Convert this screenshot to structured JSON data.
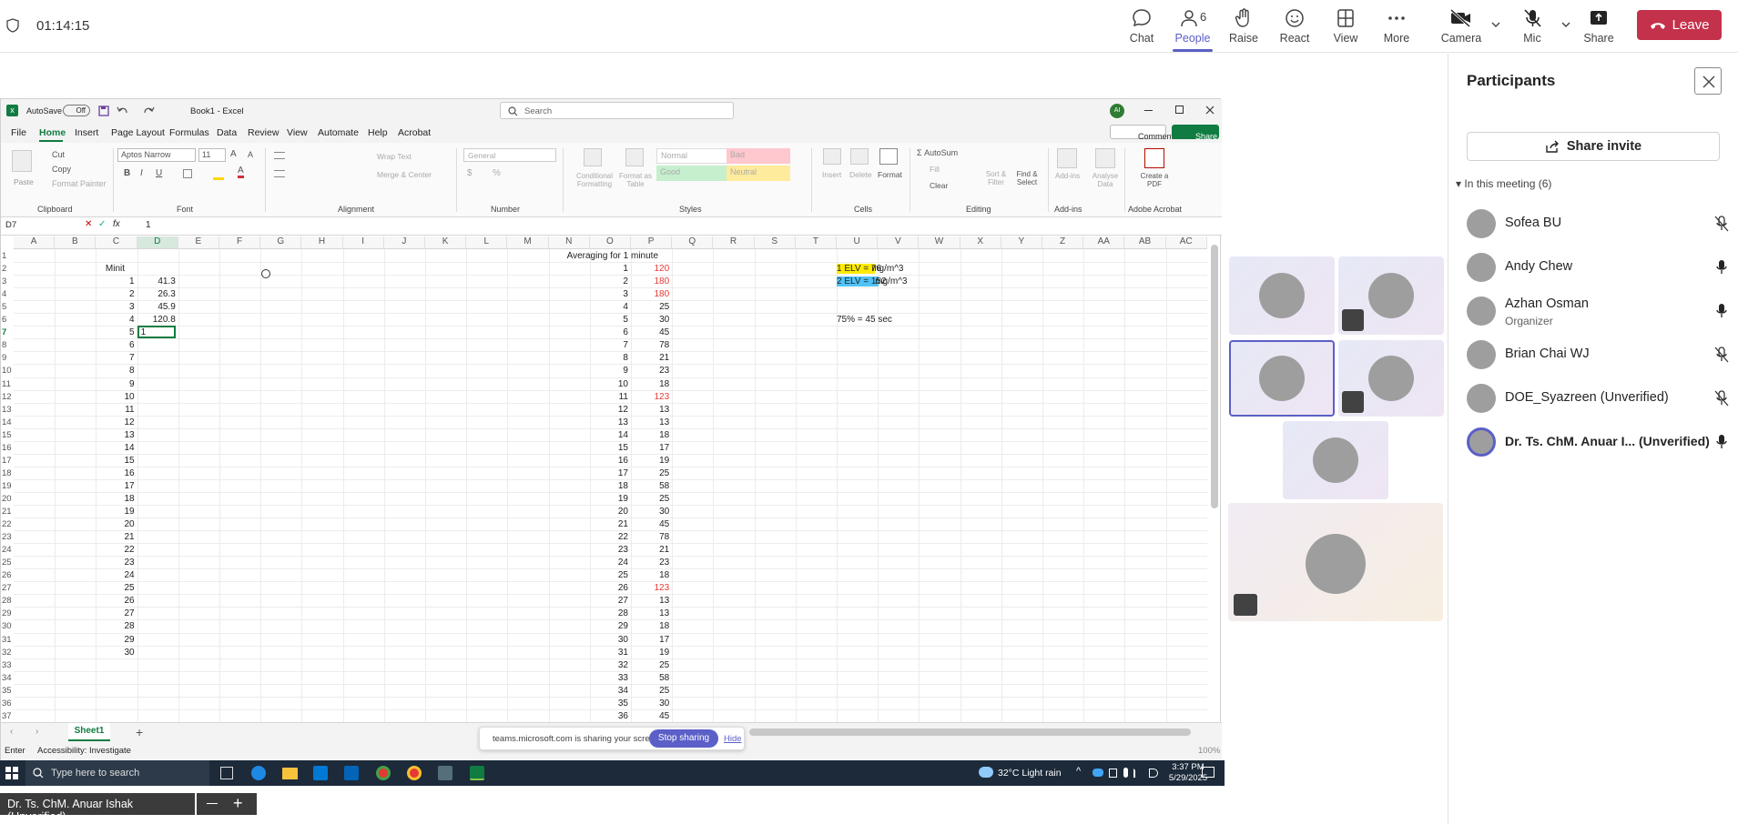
{
  "teams": {
    "timer": "01:14:15",
    "buttons": [
      {
        "label": "Chat",
        "icon": "chat-icon"
      },
      {
        "label": "People",
        "icon": "people-icon",
        "badge": "6"
      },
      {
        "label": "Raise",
        "icon": "raise-hand-icon"
      },
      {
        "label": "React",
        "icon": "react-icon"
      },
      {
        "label": "View",
        "icon": "view-icon"
      },
      {
        "label": "More",
        "icon": "more-icon"
      },
      {
        "label": "Camera",
        "icon": "camera-off-icon"
      },
      {
        "label": "Mic",
        "icon": "mic-off-icon"
      },
      {
        "label": "Share",
        "icon": "share-icon"
      }
    ],
    "leave_label": "Leave",
    "colors": {
      "accent": "#5b5fc7",
      "leave": "#c4314b"
    }
  },
  "excel": {
    "autosave_label": "AutoSave",
    "autosave_state": "Off",
    "title": "Book1 - Excel",
    "search_placeholder": "Search",
    "user_initial": "AI",
    "tabs": [
      "File",
      "Home",
      "Insert",
      "Page Layout",
      "Formulas",
      "Data",
      "Review",
      "View",
      "Automate",
      "Help",
      "Acrobat"
    ],
    "comments_label": "Comments",
    "share_label": "Share",
    "ribbon": {
      "paste": "Paste",
      "cut": "Cut",
      "copy": "Copy",
      "format_painter": "Format Painter",
      "clipboard": "Clipboard",
      "font_name": "Aptos Narrow",
      "font_size": "11",
      "font": "Font",
      "wrap_text": "Wrap Text",
      "merge_center": "Merge & Center",
      "alignment": "Alignment",
      "number_format": "General",
      "number": "Number",
      "conditional_formatting": "Conditional Formatting",
      "format_as_table": "Format as Table",
      "style_normal": "Normal",
      "style_bad": "Bad",
      "style_good": "Good",
      "style_neutral": "Neutral",
      "styles": "Styles",
      "insert": "Insert",
      "delete": "Delete",
      "format": "Format",
      "cells": "Cells",
      "autosum": "AutoSum",
      "fill": "Fill",
      "clear": "Clear",
      "sort_filter": "Sort & Filter",
      "find_select": "Find & Select",
      "editing": "Editing",
      "add_ins": "Add-ins",
      "analyse_data": "Analyse Data",
      "create_pdf": "Create a PDF",
      "adobe_acrobat": "Adobe Acrobat"
    },
    "name_box": "D7",
    "formula": "1",
    "columns": [
      "A",
      "B",
      "C",
      "D",
      "E",
      "F",
      "G",
      "H",
      "I",
      "J",
      "K",
      "L",
      "M",
      "N",
      "O",
      "P",
      "Q",
      "R",
      "S",
      "T",
      "U",
      "V",
      "W",
      "X",
      "Y",
      "Z",
      "AA",
      "AB",
      "AC"
    ],
    "rows": [
      "1",
      "2",
      "3",
      "4",
      "5",
      "6",
      "7",
      "8",
      "9",
      "10",
      "11",
      "12",
      "13",
      "14",
      "15",
      "16",
      "17",
      "18",
      "19",
      "20",
      "21",
      "22",
      "23",
      "24",
      "25",
      "26",
      "27",
      "28",
      "29",
      "30",
      "31",
      "32",
      "33",
      "34",
      "35",
      "36",
      "37"
    ],
    "minit_header": "Minit",
    "minit_values": [
      "1",
      "2",
      "3",
      "4",
      "5",
      "6",
      "7",
      "8",
      "9",
      "10",
      "11",
      "12",
      "13",
      "14",
      "15",
      "16",
      "17",
      "18",
      "19",
      "20",
      "21",
      "22",
      "23",
      "24",
      "25",
      "26",
      "27",
      "28",
      "29",
      "30"
    ],
    "d_values": [
      "41.3",
      "26.3",
      "45.9",
      "120.8",
      "1"
    ],
    "averaging_header": "Averaging for 1 minute",
    "o_values": [
      "1",
      "2",
      "3",
      "4",
      "5",
      "6",
      "7",
      "8",
      "9",
      "10",
      "11",
      "12",
      "13",
      "14",
      "15",
      "16",
      "17",
      "18",
      "19",
      "20",
      "21",
      "22",
      "23",
      "24",
      "25",
      "26",
      "27",
      "28",
      "29",
      "30",
      "31",
      "32",
      "33",
      "34",
      "35",
      "36"
    ],
    "p_values": [
      "120",
      "180",
      "180",
      "25",
      "30",
      "45",
      "78",
      "21",
      "23",
      "18",
      "123",
      "13",
      "13",
      "18",
      "17",
      "19",
      "25",
      "58",
      "25",
      "30",
      "45",
      "78",
      "21",
      "23",
      "18",
      "123",
      "13",
      "13",
      "18",
      "17",
      "19",
      "25",
      "58",
      "25",
      "30",
      "45"
    ],
    "p_red_indices": [
      0,
      1,
      2,
      10,
      25
    ],
    "elv1": "1 ELV = 76",
    "elv2": "2 ELV = 152",
    "unit": "mg/m^3",
    "note": "75% = 45 sec",
    "sheet_name": "Sheet1",
    "mode": "Enter",
    "accessibility": "Accessibility: Investigate",
    "zoom": "100%"
  },
  "share_banner": {
    "text": "teams.microsoft.com is sharing your screen.",
    "stop_label": "Stop sharing",
    "hide_label": "Hide"
  },
  "taskbar": {
    "search_placeholder": "Type here to search",
    "weather": "32°C  Light rain",
    "time": "3:37 PM",
    "date": "5/29/2025"
  },
  "presenter_label": "Dr. Ts. ChM. Anuar Ishak (Unverified)",
  "participants_panel": {
    "title": "Participants",
    "share_invite": "Share invite",
    "in_meeting": "In this meeting (6)",
    "people": [
      {
        "name": "Sofea BU",
        "role": "",
        "mic": "mic-off-icon"
      },
      {
        "name": "Andy Chew",
        "role": "",
        "mic": "mic-on-icon"
      },
      {
        "name": "Azhan Osman",
        "role": "Organizer",
        "mic": "mic-on-icon"
      },
      {
        "name": "Brian Chai WJ",
        "role": "",
        "mic": "mic-off-icon"
      },
      {
        "name": "DOE_Syazreen (Unverified)",
        "role": "",
        "mic": "mic-off-icon"
      },
      {
        "name": "Dr. Ts. ChM. Anuar I... (Unverified)",
        "role": "",
        "mic": "mic-on-icon"
      }
    ]
  }
}
